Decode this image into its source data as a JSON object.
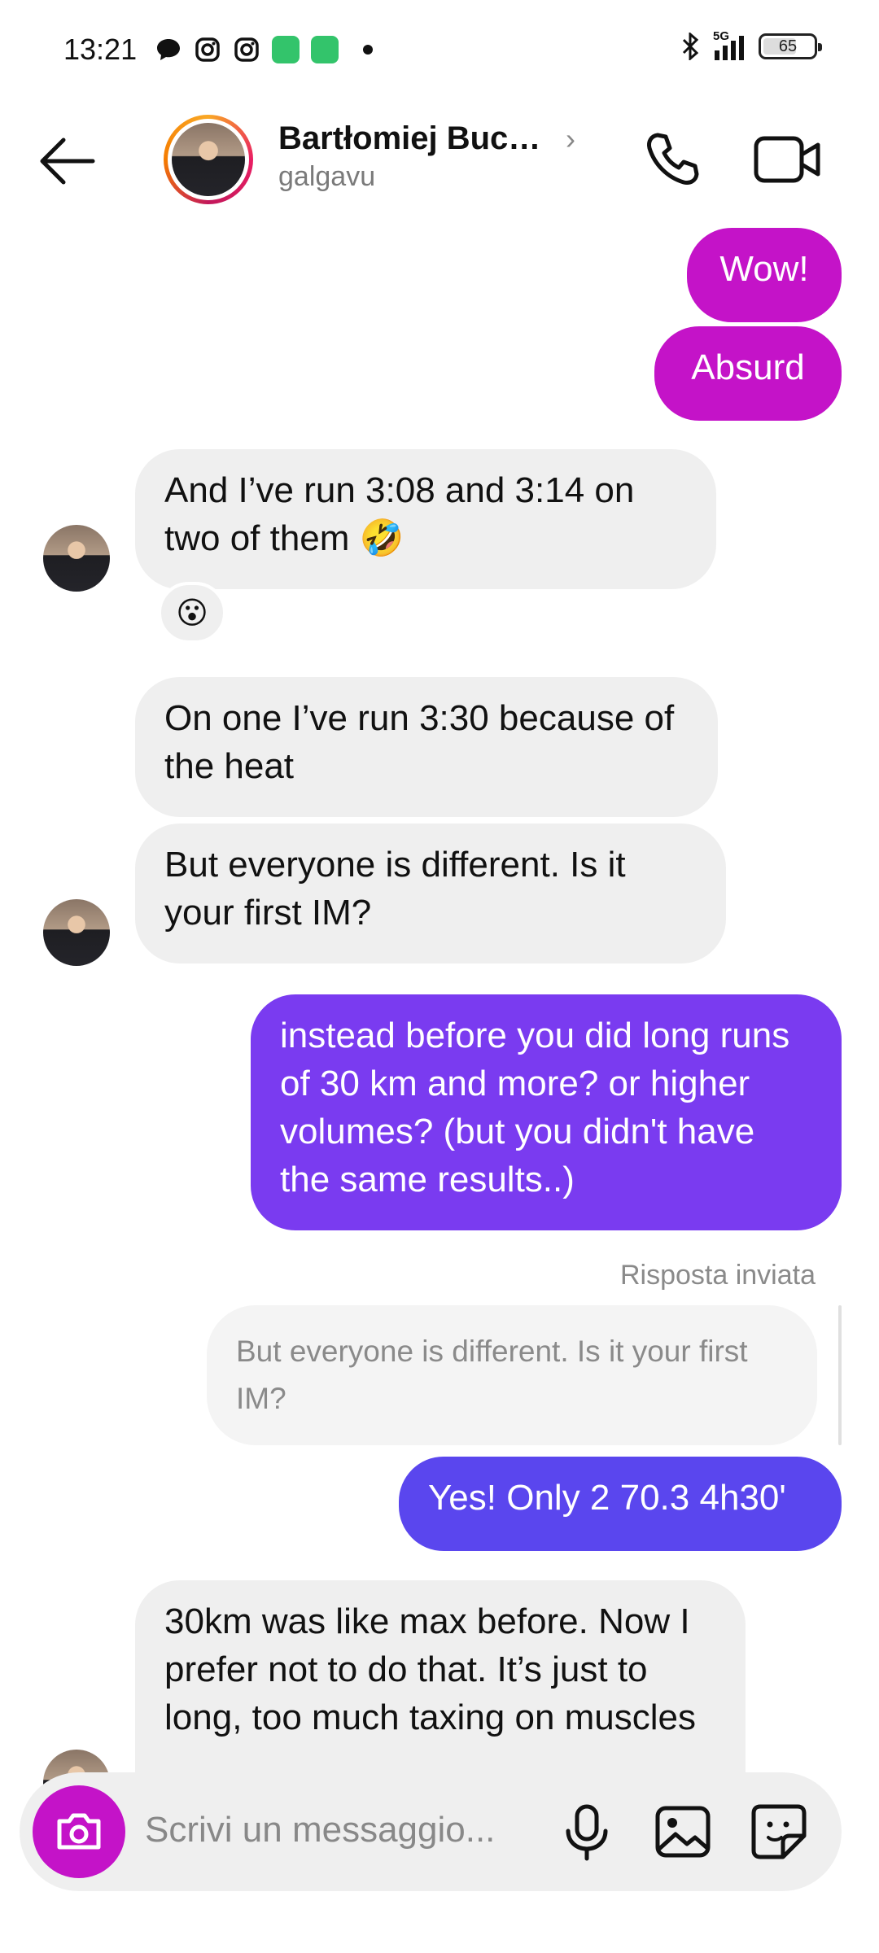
{
  "status_bar": {
    "time": "13:21",
    "network": "5G",
    "battery": "65"
  },
  "header": {
    "name": "Bartłomiej Buc…",
    "username": "galgavu"
  },
  "messages": [
    {
      "side": "out",
      "text": "Wow!"
    },
    {
      "side": "out",
      "text": "Absurd"
    },
    {
      "side": "in",
      "text": "And I’ve run 3:08 and 3:14 on two of them 🤣",
      "reaction": "😮"
    },
    {
      "side": "in",
      "text": "On one I’ve run 3:30 because of the heat"
    },
    {
      "side": "in",
      "text": "But everyone is different. Is it your first IM?"
    },
    {
      "side": "out",
      "text": "instead before you did long runs of 30 km and more? or higher volumes? (but you didn't have the same results..)"
    },
    {
      "side": "out",
      "text": "Yes! Only 2 70.3 4h30'",
      "reply_label": "Risposta inviata",
      "quoted": "But everyone is different. Is it your first IM?"
    },
    {
      "side": "in",
      "text": "30km was like max before. Now I prefer not to do that. It’s just to long, too much taxing on muscles"
    }
  ],
  "composer": {
    "placeholder": "Scrivi un messaggio..."
  },
  "colors": {
    "outgoing_pink": "#c413c8",
    "outgoing_purple": "#7a3bf0",
    "outgoing_violet": "#5a46ee",
    "incoming": "#efefef"
  }
}
